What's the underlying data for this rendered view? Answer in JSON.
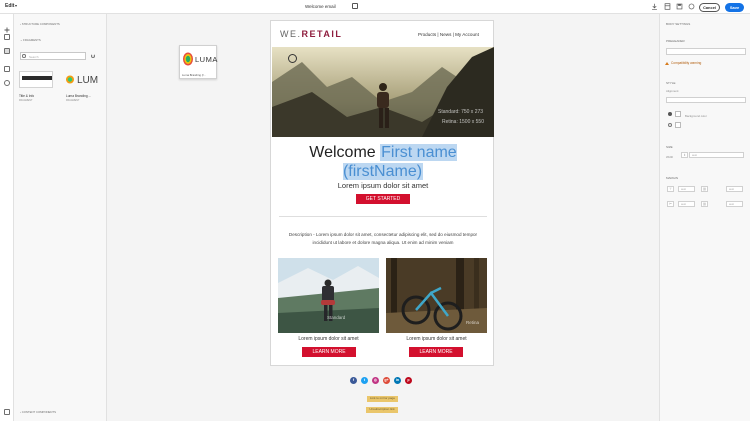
{
  "topbar": {
    "mode_label": "Edit",
    "document_title": "Welcome email",
    "cancel_label": "Cancel",
    "save_label": "Save"
  },
  "left_panel": {
    "structure_header": "Structure components",
    "fragments_header": "Fragments",
    "search_placeholder": "Search",
    "fragments": [
      {
        "name": "Title & Info",
        "sub": "FRAGMENT"
      },
      {
        "name": "Luma Branding ...",
        "sub": "FRAGMENT"
      }
    ],
    "content_header": "Content components"
  },
  "canvas": {
    "floating_logo": {
      "text": "LUMA",
      "caption": "Luma Branding (f..."
    },
    "email": {
      "brand_prefix": "WE.",
      "brand_name": "RETAIL",
      "nav": "Products  |  News  |  My Account",
      "hero_caption_1": "Standard: 750 x 273",
      "hero_caption_2": "Retina: 1500 x 550",
      "welcome_text": "Welcome ",
      "personalization": "First name (firstName)",
      "subheading": "Lorem ipsum dolor sit amet",
      "cta_label": "GET STARTED",
      "description": "Description - Lorem ipsum dolor sit amet, consectetur adipiscing elit, sed do eiusmod tempor incididunt ut labore et dolore magna aliqua. Ut enim ad minim veniam",
      "cards": [
        {
          "text": "Lorem ipsum dolor sit amet",
          "button": "LEARN MORE",
          "overlay": "Standard"
        },
        {
          "text": "Lorem ipsum dolor sit amet",
          "button": "LEARN MORE",
          "overlay": "Retina"
        }
      ]
    },
    "socials": [
      {
        "icon": "facebook-icon",
        "glyph": "f",
        "color": "#3b5998"
      },
      {
        "icon": "twitter-icon",
        "glyph": "t",
        "color": "#1da1f2"
      },
      {
        "icon": "instagram-icon",
        "glyph": "◎",
        "color": "#c13584"
      },
      {
        "icon": "googleplus-icon",
        "glyph": "g+",
        "color": "#dd4b39"
      },
      {
        "icon": "linkedin-icon",
        "glyph": "in",
        "color": "#0077b5"
      },
      {
        "icon": "pinterest-icon",
        "glyph": "p",
        "color": "#bd081c"
      }
    ],
    "footer_links": [
      "Link to mirror page",
      "Unsubscription link"
    ]
  },
  "right_panel": {
    "header": "Body settings",
    "section_preheader": "Preheader",
    "warning": "Compatibility warning",
    "section_style": "Style",
    "alignment_label": "Alignment",
    "bg_label": "Background color",
    "section_size": "Size",
    "width_label": "Width",
    "section_margin": "Margin",
    "auto": "auto",
    "unit": "px"
  },
  "colors": {
    "accent_blue": "#1473e6",
    "cta_red": "#d3102e",
    "brand_maroon": "#8f1d3e"
  }
}
